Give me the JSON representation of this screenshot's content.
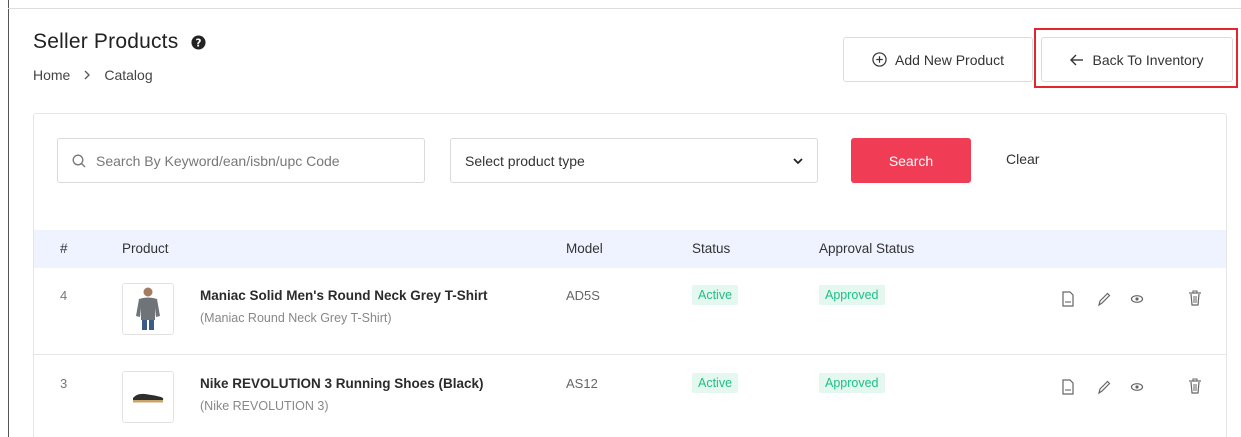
{
  "header": {
    "title": "Seller Products",
    "breadcrumb": [
      "Home",
      "Catalog"
    ]
  },
  "actions": {
    "add_label": "Add New Product",
    "back_label": "Back To Inventory",
    "highlight_color": "#e3262d"
  },
  "filters": {
    "search_placeholder": "Search By Keyword/ean/isbn/upc Code",
    "search_value": "",
    "product_type_value": "Select product type",
    "search_button": "Search",
    "clear_button": "Clear",
    "search_button_color": "#f03c55"
  },
  "table": {
    "columns": [
      "#",
      "Product",
      "Model",
      "Status",
      "Approval Status"
    ],
    "rows": [
      {
        "id": "4",
        "name": "Maniac Solid Men's Round Neck Grey T-Shirt",
        "subtitle": "(Maniac Round Neck Grey T-Shirt)",
        "model": "AD5S",
        "status": "Active",
        "approval": "Approved",
        "thumb_icon": "tshirt-icon"
      },
      {
        "id": "3",
        "name": "Nike REVOLUTION 3 Running Shoes (Black)",
        "subtitle": "(Nike REVOLUTION 3)",
        "model": "AS12",
        "status": "Active",
        "approval": "Approved",
        "thumb_icon": "shoe-icon"
      }
    ],
    "row_actions": [
      "document-icon",
      "edit-pencil-icon",
      "view-eye-icon",
      "delete-trash-icon"
    ]
  }
}
